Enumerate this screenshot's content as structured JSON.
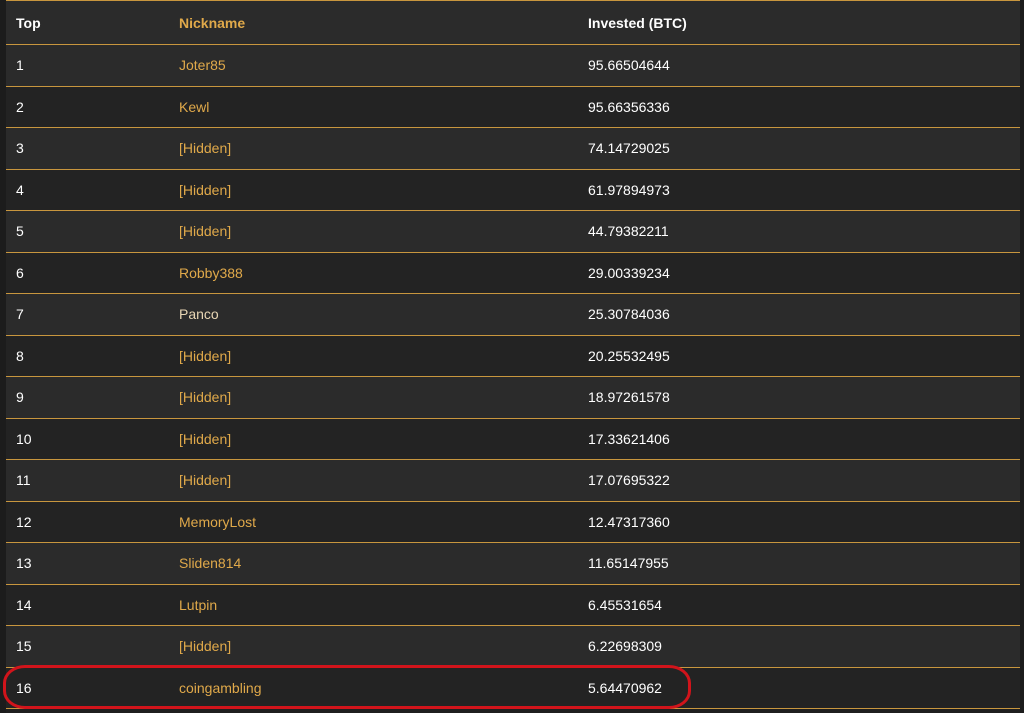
{
  "table": {
    "headers": {
      "top": "Top",
      "nickname": "Nickname",
      "invested": "Invested (BTC)"
    },
    "rows": [
      {
        "top": "1",
        "nickname": "Joter85",
        "invested": "95.66504644"
      },
      {
        "top": "2",
        "nickname": "Kewl",
        "invested": "95.66356336"
      },
      {
        "top": "3",
        "nickname": "[Hidden]",
        "invested": "74.14729025"
      },
      {
        "top": "4",
        "nickname": "[Hidden]",
        "invested": "61.97894973"
      },
      {
        "top": "5",
        "nickname": "[Hidden]",
        "invested": "44.79382211"
      },
      {
        "top": "6",
        "nickname": "Robby388",
        "invested": "29.00339234"
      },
      {
        "top": "7",
        "nickname": "Panco",
        "invested": "25.30784036"
      },
      {
        "top": "8",
        "nickname": "[Hidden]",
        "invested": "20.25532495"
      },
      {
        "top": "9",
        "nickname": "[Hidden]",
        "invested": "18.97261578"
      },
      {
        "top": "10",
        "nickname": "[Hidden]",
        "invested": "17.33621406"
      },
      {
        "top": "11",
        "nickname": "[Hidden]",
        "invested": "17.07695322"
      },
      {
        "top": "12",
        "nickname": "MemoryLost",
        "invested": "12.47317360"
      },
      {
        "top": "13",
        "nickname": "Sliden814",
        "invested": "11.65147955"
      },
      {
        "top": "14",
        "nickname": "Lutpin",
        "invested": "6.45531654"
      },
      {
        "top": "15",
        "nickname": "[Hidden]",
        "invested": "6.22698309"
      },
      {
        "top": "16",
        "nickname": "coingambling",
        "invested": "5.64470962"
      }
    ]
  },
  "colors": {
    "accent_border": "#c8963e",
    "nickname_text": "#e0a94a",
    "highlight_ring": "#d1141b",
    "background": "#1f1f1f"
  }
}
